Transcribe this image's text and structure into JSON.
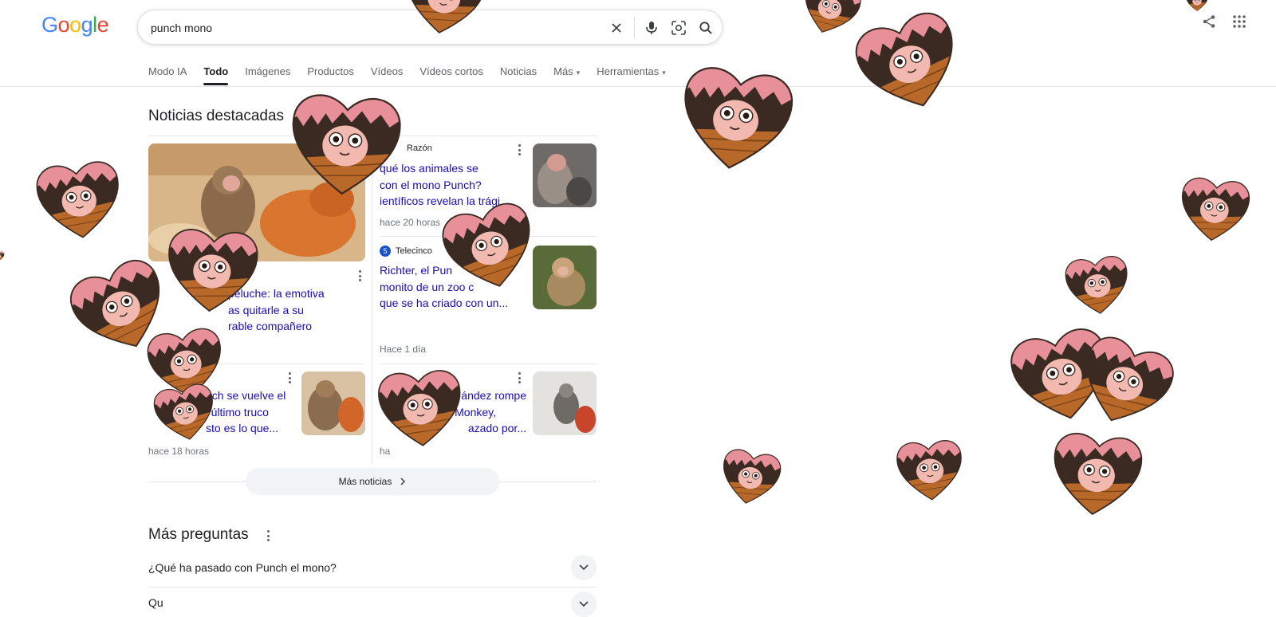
{
  "header": {
    "logo": [
      "G",
      "o",
      "o",
      "g",
      "l",
      "e"
    ],
    "search_value": "punch mono"
  },
  "tabs": [
    {
      "label": "Modo IA",
      "active": false
    },
    {
      "label": "Todo",
      "active": true
    },
    {
      "label": "Imágenes",
      "active": false
    },
    {
      "label": "Productos",
      "active": false
    },
    {
      "label": "Vídeos",
      "active": false
    },
    {
      "label": "Vídeos cortos",
      "active": false
    },
    {
      "label": "Noticias",
      "active": false
    },
    {
      "label": "Más",
      "active": false,
      "caret": true
    },
    {
      "label": "Herramientas",
      "active": false,
      "caret": true
    }
  ],
  "news": {
    "title": "Noticias destacadas",
    "main_snippet_lines": [
      "peluche: la emotiva",
      "as quitarle a su",
      "rable compañero"
    ],
    "right_top": {
      "source": "Razón",
      "headline_lines": [
        "qué los animales se",
        "con el mono Punch?",
        "ientíficos revelan la trági"
      ],
      "time": "hace 20 horas"
    },
    "right_mid": {
      "source": "Telecinco",
      "headline_lines": [
        "Richter, el Pun",
        "monito de un zoo c",
        "que se ha criado con un..."
      ],
      "time": "Hace 1 día"
    },
    "left_bottom": {
      "headline_lines": [
        "nch se vuelve el",
        "del último truco",
        "sto es lo que..."
      ],
      "time": "hace 18 horas"
    },
    "right_bottom": {
      "headline_lines": [
        "ández rompe",
        "h Monkey,",
        "azado por..."
      ],
      "time": "ha"
    },
    "more_label": "Más noticias"
  },
  "paa": {
    "title": "Más preguntas",
    "questions": [
      "¿Qué ha pasado con Punch el mono?",
      "Qu"
    ]
  },
  "colors": {
    "link": "#1a0dab",
    "heart_pink": "#e8909a",
    "heart_brown": "#b8692a",
    "fur": "#3a2a22",
    "face": "#f2b9b0"
  },
  "icons": [
    "clear-icon",
    "mic-icon",
    "lens-icon",
    "search-icon",
    "share-icon",
    "apps-grid-icon",
    "chevron-right-icon",
    "chevron-down-icon",
    "more-vert-icon"
  ]
}
